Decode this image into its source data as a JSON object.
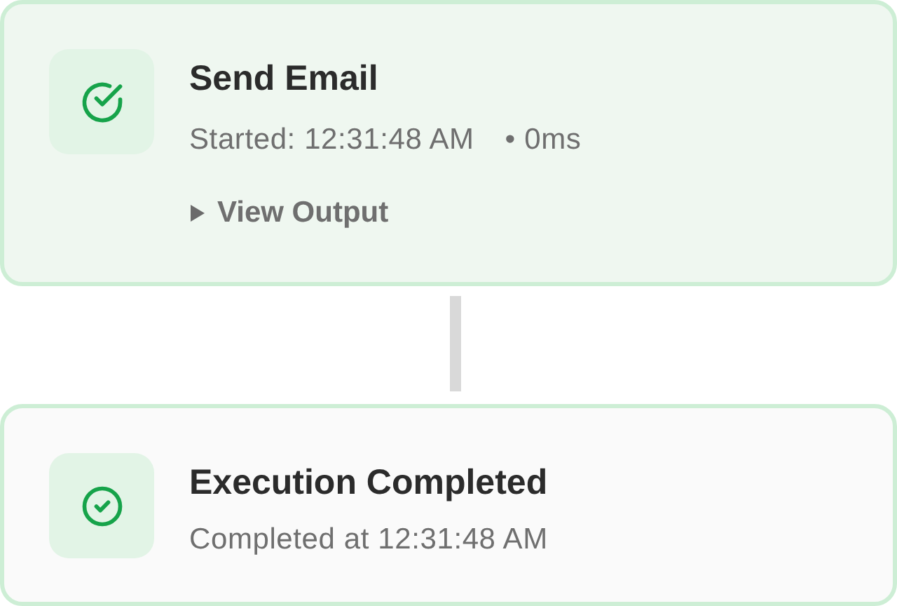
{
  "steps": [
    {
      "kind": "step",
      "succeeded": true,
      "title": "Send Email",
      "started": "Started: 12:31:48 AM",
      "duration": "• 0ms",
      "output": {
        "label": "View Output",
        "expanded": false
      }
    },
    {
      "kind": "completion",
      "succeeded": true,
      "title": "Execution Completed",
      "detail": "Completed at 12:31:48 AM"
    }
  ]
}
